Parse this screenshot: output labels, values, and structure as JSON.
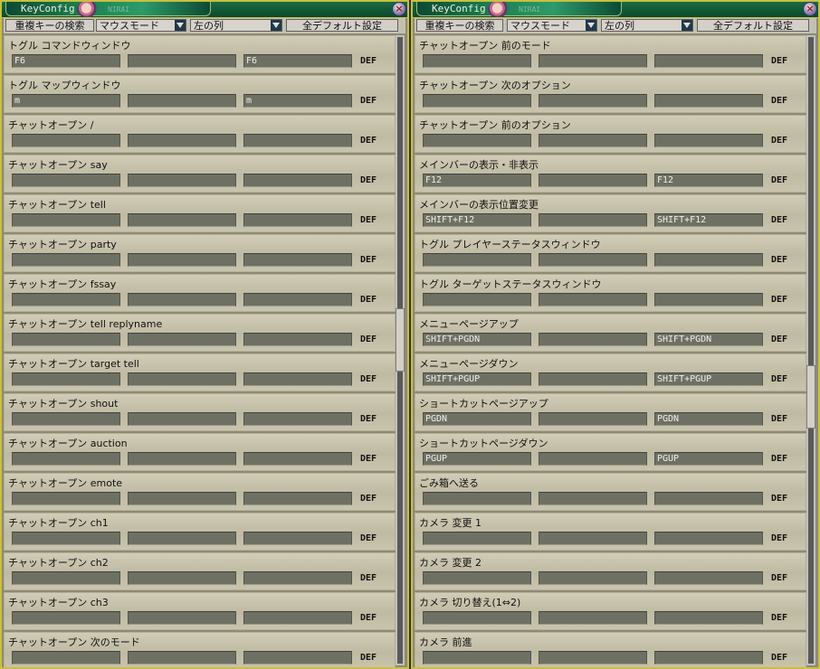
{
  "window_title": "KeyConfig",
  "title_ghost": "NIRAI",
  "toolbar": {
    "duplicate_search": "重複キーの検索",
    "mode_select": "マウスモード",
    "column_select": "左の列",
    "all_default": "全デフォルト設定"
  },
  "def_label": "DEF",
  "left_entries": [
    {
      "label": "トグル コマンドウィンドウ",
      "keys": [
        "F6",
        "",
        "F6"
      ]
    },
    {
      "label": "トグル マップウィンドウ",
      "keys": [
        "m",
        "",
        "m"
      ]
    },
    {
      "label": "チャットオープン /",
      "keys": [
        "",
        "",
        ""
      ]
    },
    {
      "label": "チャットオープン say",
      "keys": [
        "",
        "",
        ""
      ]
    },
    {
      "label": "チャットオープン tell",
      "keys": [
        "",
        "",
        ""
      ]
    },
    {
      "label": "チャットオープン party",
      "keys": [
        "",
        "",
        ""
      ]
    },
    {
      "label": "チャットオープン fssay",
      "keys": [
        "",
        "",
        ""
      ]
    },
    {
      "label": "チャットオープン tell replyname",
      "keys": [
        "",
        "",
        ""
      ]
    },
    {
      "label": "チャットオープン target tell",
      "keys": [
        "",
        "",
        ""
      ]
    },
    {
      "label": "チャットオープン shout",
      "keys": [
        "",
        "",
        ""
      ]
    },
    {
      "label": "チャットオープン auction",
      "keys": [
        "",
        "",
        ""
      ]
    },
    {
      "label": "チャットオープン emote",
      "keys": [
        "",
        "",
        ""
      ]
    },
    {
      "label": "チャットオープン ch1",
      "keys": [
        "",
        "",
        ""
      ]
    },
    {
      "label": "チャットオープン ch2",
      "keys": [
        "",
        "",
        ""
      ]
    },
    {
      "label": "チャットオープン ch3",
      "keys": [
        "",
        "",
        ""
      ]
    },
    {
      "label": "チャットオープン 次のモード",
      "keys": [
        "",
        "",
        ""
      ]
    }
  ],
  "right_entries": [
    {
      "label": "チャットオープン 前のモード",
      "keys": [
        "",
        "",
        ""
      ]
    },
    {
      "label": "チャットオープン 次のオプション",
      "keys": [
        "",
        "",
        ""
      ]
    },
    {
      "label": "チャットオープン 前のオプション",
      "keys": [
        "",
        "",
        ""
      ]
    },
    {
      "label": "メインバーの表示・非表示",
      "keys": [
        "F12",
        "",
        "F12"
      ]
    },
    {
      "label": "メインバーの表示位置変更",
      "keys": [
        "SHIFT+F12",
        "",
        "SHIFT+F12"
      ]
    },
    {
      "label": "トグル プレイヤーステータスウィンドウ",
      "keys": [
        "",
        "",
        ""
      ]
    },
    {
      "label": "トグル ターゲットステータスウィンドウ",
      "keys": [
        "",
        "",
        ""
      ]
    },
    {
      "label": "メニューページアップ",
      "keys": [
        "SHIFT+PGDN",
        "",
        "SHIFT+PGDN"
      ]
    },
    {
      "label": "メニューページダウン",
      "keys": [
        "SHIFT+PGUP",
        "",
        "SHIFT+PGUP"
      ]
    },
    {
      "label": "ショートカットページアップ",
      "keys": [
        "PGDN",
        "",
        "PGDN"
      ]
    },
    {
      "label": "ショートカットページダウン",
      "keys": [
        "PGUP",
        "",
        "PGUP"
      ]
    },
    {
      "label": "ごみ箱へ送る",
      "keys": [
        "",
        "",
        ""
      ]
    },
    {
      "label": "カメラ 変更 1",
      "keys": [
        "",
        "",
        ""
      ]
    },
    {
      "label": "カメラ 変更 2",
      "keys": [
        "",
        "",
        ""
      ]
    },
    {
      "label": "カメラ 切り替え(1⇔2)",
      "keys": [
        "",
        "",
        ""
      ]
    },
    {
      "label": "カメラ 前進",
      "keys": [
        "",
        "",
        ""
      ]
    }
  ],
  "scroll": {
    "left_position": 0.48,
    "right_position": 0.58
  }
}
